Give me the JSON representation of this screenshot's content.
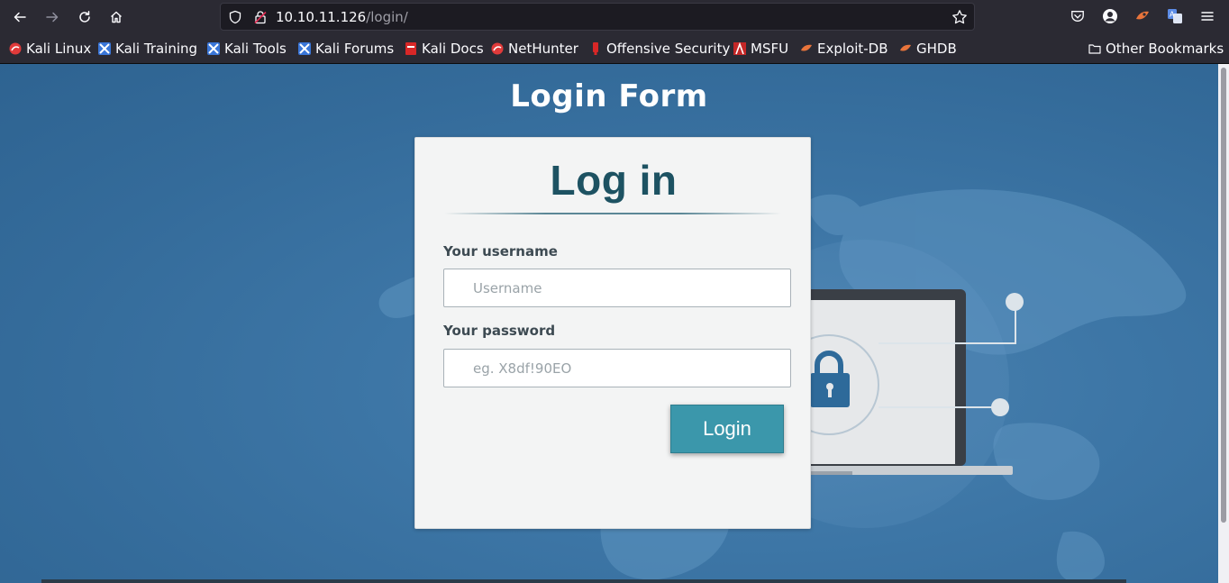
{
  "browser": {
    "url_host": "10.10.11.126",
    "url_path": "/login/",
    "nav_icons": [
      "back-icon",
      "forward-icon",
      "reload-icon",
      "home-icon"
    ],
    "toolbar_icons": [
      "pocket-icon",
      "account-icon",
      "extension-icon",
      "translate-icon",
      "menu-icon"
    ]
  },
  "bookmarks": {
    "items": [
      {
        "label": "Kali Linux",
        "icon": "kali-linux-icon"
      },
      {
        "label": "Kali Training",
        "icon": "kali-training-icon"
      },
      {
        "label": "Kali Tools",
        "icon": "kali-tools-icon"
      },
      {
        "label": "Kali Forums",
        "icon": "kali-forums-icon"
      },
      {
        "label": "Kali Docs",
        "icon": "kali-docs-icon"
      },
      {
        "label": "NetHunter",
        "icon": "nethunter-icon"
      },
      {
        "label": "Offensive Security",
        "icon": "offensive-security-icon"
      },
      {
        "label": "MSFU",
        "icon": "msfu-icon"
      },
      {
        "label": "Exploit-DB",
        "icon": "exploit-db-icon"
      },
      {
        "label": "GHDB",
        "icon": "ghdb-icon"
      }
    ],
    "other_label": "Other Bookmarks"
  },
  "page": {
    "title": "Login Form",
    "card": {
      "heading": "Log in",
      "username_label": "Your username",
      "username_placeholder": "Username",
      "username_value": "",
      "password_label": "Your password",
      "password_placeholder": "eg. X8df!90EO",
      "password_value": "",
      "login_button": "Login"
    }
  },
  "colors": {
    "page_bg": "#3d76a6",
    "button": "#3b97ab",
    "heading": "#1d5262",
    "chrome": "#2b2a33"
  }
}
